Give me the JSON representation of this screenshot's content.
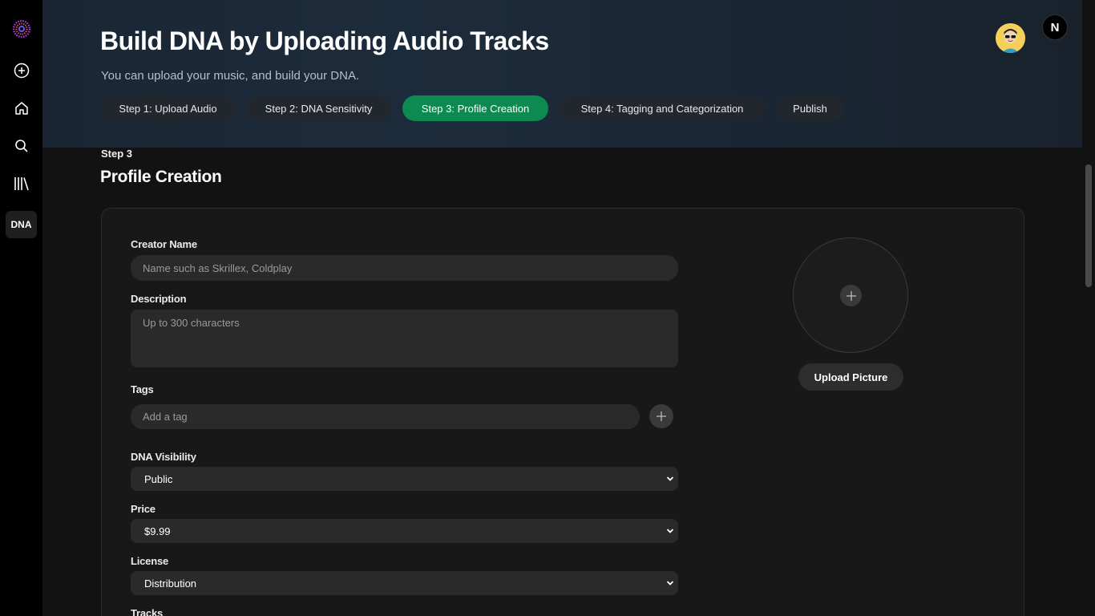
{
  "header": {
    "title": "Build DNA by Uploading Audio Tracks",
    "subtitle": "You can upload your music, and build your DNA.",
    "steps": [
      {
        "label": "Step 1: Upload Audio",
        "active": false
      },
      {
        "label": "Step 2: DNA Sensitivity",
        "active": false
      },
      {
        "label": "Step 3: Profile Creation",
        "active": true
      },
      {
        "label": "Step 4: Tagging and Categorization",
        "active": false
      },
      {
        "label": "Publish",
        "active": false
      }
    ],
    "logo_letter": "N"
  },
  "sidebar": {
    "items": [
      {
        "icon": "brand-logo-icon"
      },
      {
        "icon": "plus-circle-icon"
      },
      {
        "icon": "home-icon"
      },
      {
        "icon": "search-icon"
      },
      {
        "icon": "library-icon"
      },
      {
        "label": "DNA"
      }
    ]
  },
  "content": {
    "step_label": "Step 3",
    "section_title": "Profile Creation",
    "creator_name": {
      "label": "Creator Name",
      "placeholder": "Name such as Skrillex, Coldplay",
      "value": ""
    },
    "description": {
      "label": "Description",
      "placeholder": "Up to 300 characters",
      "value": ""
    },
    "tags": {
      "label": "Tags",
      "placeholder": "Add a tag"
    },
    "visibility": {
      "label": "DNA Visibility",
      "value": "Public"
    },
    "price": {
      "label": "Price",
      "value": "$9.99"
    },
    "license": {
      "label": "License",
      "value": "Distribution"
    },
    "tracks": {
      "label": "Tracks"
    },
    "upload_picture_label": "Upload Picture"
  },
  "colors": {
    "accent": "#0c8a4f",
    "background": "#121212",
    "card": "#181818",
    "input": "#2a2a2a"
  }
}
